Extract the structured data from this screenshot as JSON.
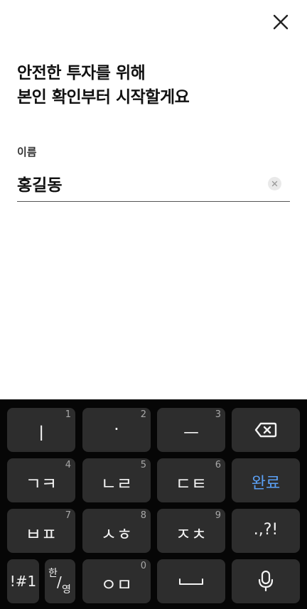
{
  "header": {
    "close_icon": "close-icon"
  },
  "title": {
    "line1": "안전한 투자를 위해",
    "line2": "본인 확인부터 시작할게요"
  },
  "form": {
    "name_label": "이름",
    "name_value": "홍길동",
    "clear_icon": "clear-icon"
  },
  "keyboard": {
    "keys": [
      {
        "label": "ㅣ",
        "num": "1"
      },
      {
        "label": "·",
        "num": "2"
      },
      {
        "label": "ㅡ",
        "num": "3"
      },
      {
        "icon": "backspace-icon"
      },
      {
        "label": "ㄱㅋ",
        "num": "4"
      },
      {
        "label": "ㄴㄹ",
        "num": "5"
      },
      {
        "label": "ㄷㅌ",
        "num": "6"
      },
      {
        "label": "완료"
      },
      {
        "label": "ㅂㅍ",
        "num": "7"
      },
      {
        "label": "ㅅㅎ",
        "num": "8"
      },
      {
        "label": "ㅈㅊ",
        "num": "9"
      },
      {
        "label": ".,?!"
      },
      {
        "label": "!#1"
      },
      {
        "label_top": "한",
        "label_bottom": "영",
        "separator": "/"
      },
      {
        "label": "ㅇㅁ",
        "num": "0"
      },
      {
        "icon": "space-icon"
      },
      {
        "icon": "microphone-icon"
      }
    ],
    "accent_color": "#5ba0f5"
  }
}
